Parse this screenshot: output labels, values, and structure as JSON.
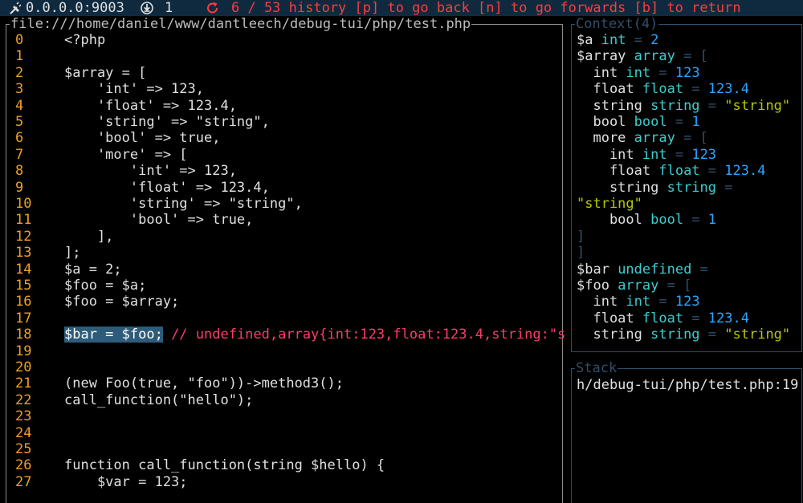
{
  "status_bar": {
    "address": "0.0.0.0:9003",
    "connections": "1",
    "history": "6 / 53 history [p] to go back [n] to go forwards [b] to return",
    "colors": {
      "background": "#0f2a3f",
      "history": "#ff3b3b"
    }
  },
  "source": {
    "title": "file:///home/daniel/www/dantleech/debug-tui/php/test.php",
    "lines": [
      {
        "n": "0",
        "code": "<?php"
      },
      {
        "n": "1",
        "code": ""
      },
      {
        "n": "2",
        "code": "$array = ["
      },
      {
        "n": "3",
        "code": "    'int' => 123,"
      },
      {
        "n": "4",
        "code": "    'float' => 123.4,"
      },
      {
        "n": "5",
        "code": "    'string' => \"string\","
      },
      {
        "n": "6",
        "code": "    'bool' => true,"
      },
      {
        "n": "7",
        "code": "    'more' => ["
      },
      {
        "n": "8",
        "code": "        'int' => 123,"
      },
      {
        "n": "9",
        "code": "        'float' => 123.4,"
      },
      {
        "n": "10",
        "code": "        'string' => \"string\","
      },
      {
        "n": "11",
        "code": "        'bool' => true,"
      },
      {
        "n": "12",
        "code": "    ],"
      },
      {
        "n": "13",
        "code": "];"
      },
      {
        "n": "14",
        "code": "$a = 2;"
      },
      {
        "n": "15",
        "code": "$foo = $a;"
      },
      {
        "n": "16",
        "code": "$foo = $array;"
      },
      {
        "n": "17",
        "code": ""
      },
      {
        "n": "18",
        "code": "$bar = $foo;",
        "current": true,
        "comment": " // undefined,array{int:123,float:123.4,string:\"s"
      },
      {
        "n": "19",
        "code": ""
      },
      {
        "n": "20",
        "code": ""
      },
      {
        "n": "21",
        "code": "(new Foo(true, \"foo\"))->method3();"
      },
      {
        "n": "22",
        "code": "call_function(\"hello\");"
      },
      {
        "n": "23",
        "code": ""
      },
      {
        "n": "24",
        "code": ""
      },
      {
        "n": "25",
        "code": ""
      },
      {
        "n": "26",
        "code": "function call_function(string $hello) {"
      },
      {
        "n": "27",
        "code": "    $var = 123;"
      }
    ]
  },
  "context": {
    "title": "Context(4)",
    "lines": [
      [
        {
          "t": "$a ",
          "k": "name"
        },
        {
          "t": "int",
          "k": "type"
        },
        {
          "t": " = ",
          "k": "eq"
        },
        {
          "t": "2",
          "k": "num"
        }
      ],
      [
        {
          "t": "$array ",
          "k": "name"
        },
        {
          "t": "array",
          "k": "type"
        },
        {
          "t": " = [",
          "k": "eq"
        }
      ],
      [
        {
          "t": "  int ",
          "k": "name"
        },
        {
          "t": "int",
          "k": "type"
        },
        {
          "t": " = ",
          "k": "eq"
        },
        {
          "t": "123",
          "k": "num"
        }
      ],
      [
        {
          "t": "  float ",
          "k": "name"
        },
        {
          "t": "float",
          "k": "type"
        },
        {
          "t": " = ",
          "k": "eq"
        },
        {
          "t": "123.4",
          "k": "num"
        }
      ],
      [
        {
          "t": "  string ",
          "k": "name"
        },
        {
          "t": "string",
          "k": "type"
        },
        {
          "t": " = ",
          "k": "eq"
        },
        {
          "t": "\"string\"",
          "k": "str"
        }
      ],
      [
        {
          "t": "  bool ",
          "k": "name"
        },
        {
          "t": "bool",
          "k": "type"
        },
        {
          "t": " = ",
          "k": "eq"
        },
        {
          "t": "1",
          "k": "num"
        }
      ],
      [
        {
          "t": "  more ",
          "k": "name"
        },
        {
          "t": "array",
          "k": "type"
        },
        {
          "t": " = [",
          "k": "eq"
        }
      ],
      [
        {
          "t": "    int ",
          "k": "name"
        },
        {
          "t": "int",
          "k": "type"
        },
        {
          "t": " = ",
          "k": "eq"
        },
        {
          "t": "123",
          "k": "num"
        }
      ],
      [
        {
          "t": "    float ",
          "k": "name"
        },
        {
          "t": "float",
          "k": "type"
        },
        {
          "t": " = ",
          "k": "eq"
        },
        {
          "t": "123.4",
          "k": "num"
        }
      ],
      [
        {
          "t": "    string ",
          "k": "name"
        },
        {
          "t": "string",
          "k": "type"
        },
        {
          "t": " =",
          "k": "eq"
        }
      ],
      [
        {
          "t": "\"string\"",
          "k": "str"
        }
      ],
      [
        {
          "t": "    bool ",
          "k": "name"
        },
        {
          "t": "bool",
          "k": "type"
        },
        {
          "t": " = ",
          "k": "eq"
        },
        {
          "t": "1",
          "k": "num"
        }
      ],
      [
        {
          "t": "]",
          "k": "br"
        }
      ],
      [
        {
          "t": "]",
          "k": "br"
        }
      ],
      [
        {
          "t": "$bar ",
          "k": "name"
        },
        {
          "t": "undefined",
          "k": "type"
        },
        {
          "t": " =",
          "k": "eq"
        }
      ],
      [
        {
          "t": "$foo ",
          "k": "name"
        },
        {
          "t": "array",
          "k": "type"
        },
        {
          "t": " = [",
          "k": "eq"
        }
      ],
      [
        {
          "t": "  int ",
          "k": "name"
        },
        {
          "t": "int",
          "k": "type"
        },
        {
          "t": " = ",
          "k": "eq"
        },
        {
          "t": "123",
          "k": "num"
        }
      ],
      [
        {
          "t": "  float ",
          "k": "name"
        },
        {
          "t": "float",
          "k": "type"
        },
        {
          "t": " = ",
          "k": "eq"
        },
        {
          "t": "123.4",
          "k": "num"
        }
      ],
      [
        {
          "t": "  string ",
          "k": "name"
        },
        {
          "t": "string",
          "k": "type"
        },
        {
          "t": " = ",
          "k": "eq"
        },
        {
          "t": "\"string\"",
          "k": "str"
        }
      ]
    ]
  },
  "stack": {
    "title": "Stack",
    "frames": [
      "h/debug-tui/php/test.php:19"
    ]
  }
}
